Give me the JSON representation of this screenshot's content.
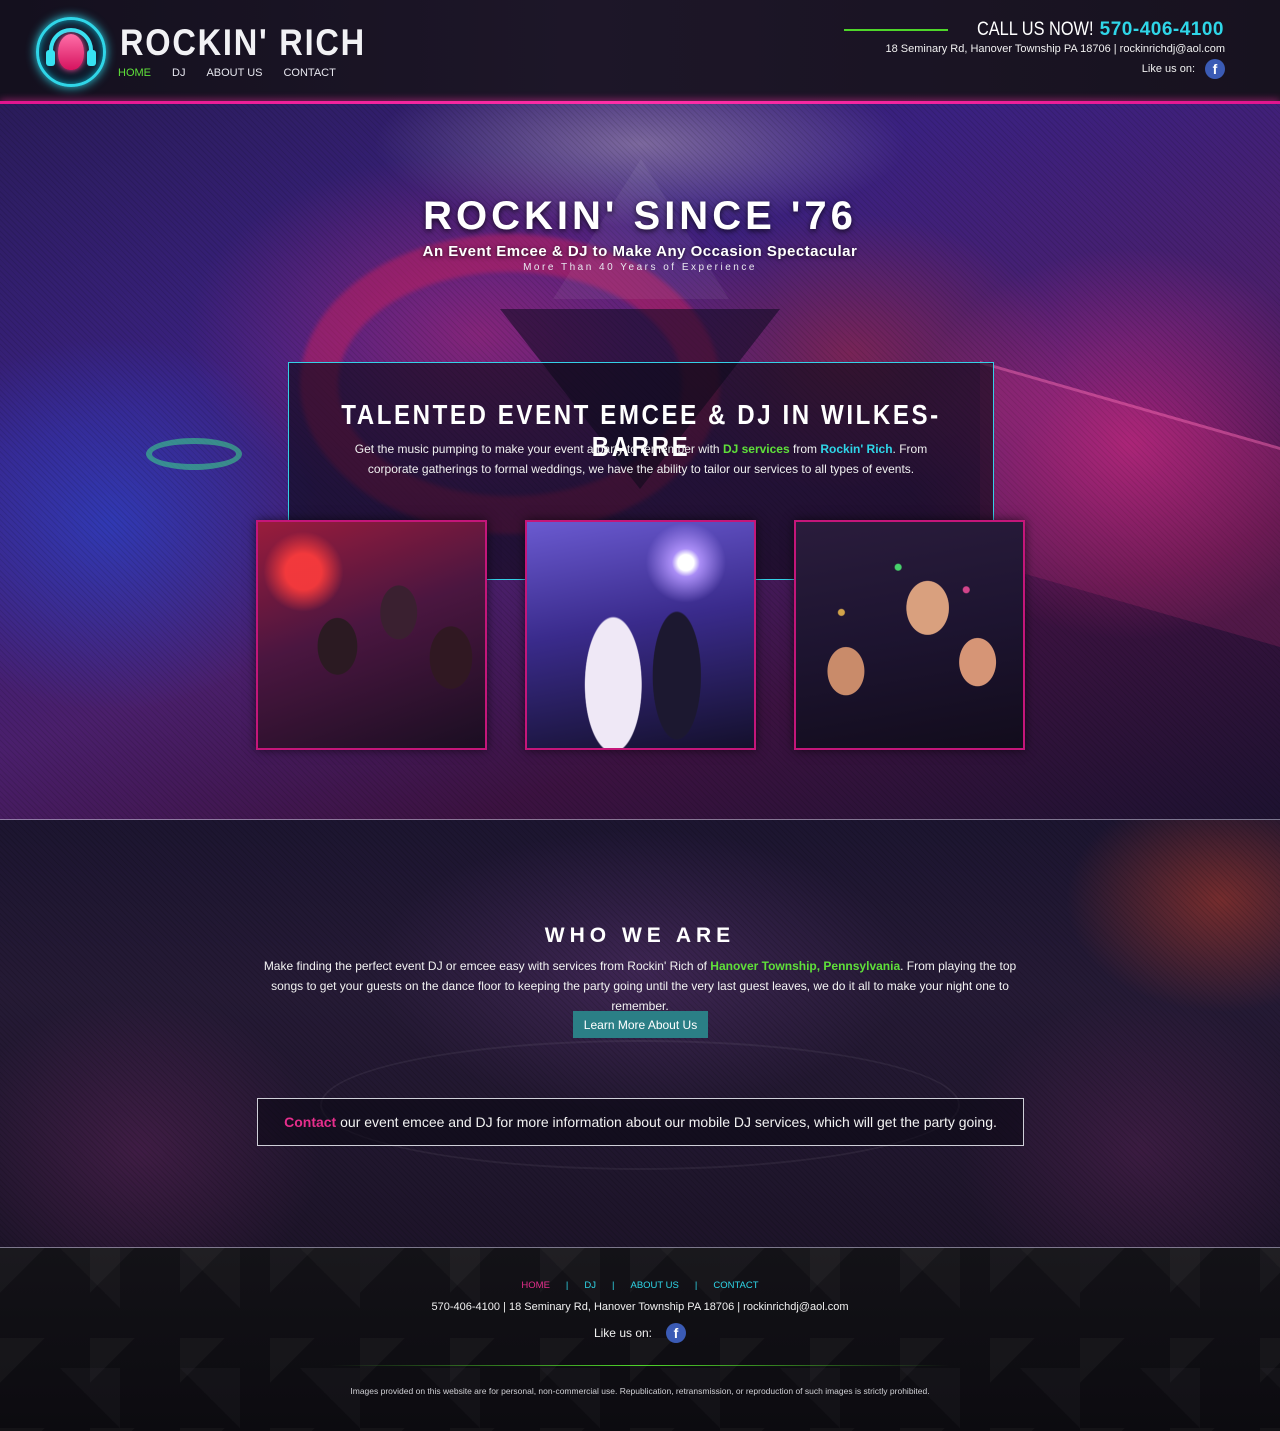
{
  "header": {
    "brand": "ROCKIN' RICH",
    "nav": [
      "HOME",
      "DJ",
      "ABOUT US",
      "CONTACT"
    ],
    "active_nav": "HOME",
    "call_label": "CALL US NOW!",
    "phone": "570-406-4100",
    "address_line": "18 Seminary Rd, Hanover Township PA 18706 | rockinrichdj@aol.com",
    "like_label": "Like us on:",
    "facebook_icon": "facebook-icon"
  },
  "hero": {
    "title": "ROCKIN' SINCE '76",
    "subtitle": "An Event Emcee & DJ to Make Any Occasion Spectacular",
    "tagline": "More Than 40 Years of Experience",
    "intro": {
      "heading": "TALENTED EVENT EMCEE & DJ IN WILKES-BARRE",
      "text_1": "Get the music pumping to make your event a party to remember with ",
      "link_1": "DJ services",
      "text_2": " from ",
      "link_2": "Rockin' Rich",
      "text_3": ". From corporate gatherings to formal weddings, we have the ability to tailor our services to all types of events."
    },
    "photos": [
      "party-crowd-photo",
      "wedding-dance-photo",
      "confetti-party-photo"
    ]
  },
  "who": {
    "title": "WHO WE ARE",
    "text_1": "Make finding the perfect event DJ or emcee easy with services from Rockin' Rich of ",
    "location": "Hanover Township, Pennsylvania",
    "text_2": ". From playing the top songs to get your guests on the dance floor to keeping the party going until the very last guest leaves, we do it all to make your night one to remember.",
    "button": "Learn More About Us",
    "contact_link": "Contact",
    "contact_text": " our event emcee and DJ for more information about our mobile DJ services, which will get the party going."
  },
  "footer": {
    "nav": [
      "HOME",
      "DJ",
      "ABOUT US",
      "CONTACT"
    ],
    "separator": "|",
    "info": "570-406-4100 | 18 Seminary Rd, Hanover Township PA 18706 | rockinrichdj@aol.com",
    "like_label": "Like us on:",
    "copyright": "Images provided on this website are for personal, non-commercial use. Republication, retransmission, or reproduction of such images is strictly prohibited."
  },
  "colors": {
    "accent_cyan": "#2fd6e8",
    "accent_green": "#5fe03a",
    "accent_pink": "#e62e8c",
    "button_teal": "#2b7f86"
  }
}
